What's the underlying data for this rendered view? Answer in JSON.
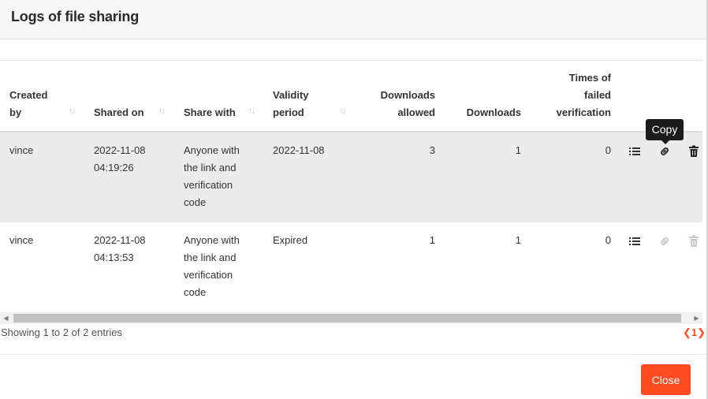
{
  "modal": {
    "title": "Logs of file sharing"
  },
  "table": {
    "headers": {
      "created_by": [
        "Created",
        "by"
      ],
      "shared_on": "Shared on",
      "share_with": "Share with",
      "validity_period": [
        "Validity",
        "period"
      ],
      "downloads_allowed": [
        "Downloads",
        "allowed"
      ],
      "downloads": "Downloads",
      "failed": [
        "Times of",
        "failed",
        "verification"
      ],
      "sort_glyph": "↑↓"
    },
    "rows": [
      {
        "created_by": "vince",
        "shared_on": [
          "2022-11-08",
          "04:19:26"
        ],
        "share_with": [
          "Anyone with",
          "the link and",
          "verification",
          "code"
        ],
        "validity": "2022-11-08",
        "downloads_allowed": "3",
        "downloads": "1",
        "failed": "0",
        "highlighted": true
      },
      {
        "created_by": "vince",
        "shared_on": [
          "2022-11-08",
          "04:13:53"
        ],
        "share_with": [
          "Anyone with",
          "the link and",
          "verification",
          "code"
        ],
        "validity": "Expired",
        "downloads_allowed": "1",
        "downloads": "1",
        "failed": "0",
        "highlighted": false
      }
    ]
  },
  "tooltip": {
    "text": "Copy"
  },
  "icons": [
    "list-icon",
    "link-icon",
    "trash-icon"
  ],
  "footer": {
    "info": "Showing 1 to 2 of 2 entries",
    "pager": {
      "prev": "❮",
      "page": "1",
      "next": "❯"
    },
    "close_label": "Close"
  },
  "colors": {
    "accent": "#ff4b1f",
    "row_highlight": "#ececec",
    "tooltip_bg": "#1c1c1c"
  }
}
